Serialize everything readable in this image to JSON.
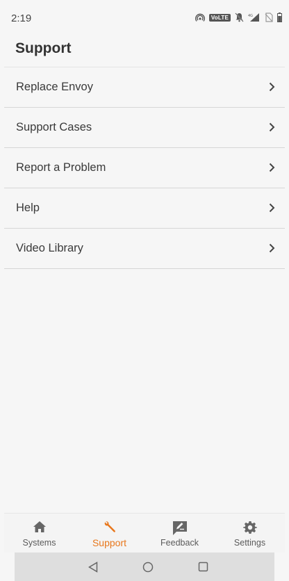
{
  "status_bar": {
    "time": "2:19",
    "volte": "VoLTE"
  },
  "header": {
    "title": "Support"
  },
  "menu": {
    "items": [
      {
        "label": "Replace Envoy"
      },
      {
        "label": "Support Cases"
      },
      {
        "label": "Report a Problem"
      },
      {
        "label": "Help"
      },
      {
        "label": "Video Library"
      }
    ]
  },
  "bottom_nav": {
    "items": [
      {
        "label": "Systems",
        "icon": "home-icon",
        "active": false
      },
      {
        "label": "Support",
        "icon": "wrench-icon",
        "active": true
      },
      {
        "label": "Feedback",
        "icon": "feedback-icon",
        "active": false
      },
      {
        "label": "Settings",
        "icon": "gear-icon",
        "active": false
      }
    ]
  },
  "colors": {
    "accent": "#e8771c",
    "background": "#f6f6f6",
    "divider": "#d6d6d6",
    "text": "#3a3a3a",
    "icon_inactive": "#666666"
  }
}
